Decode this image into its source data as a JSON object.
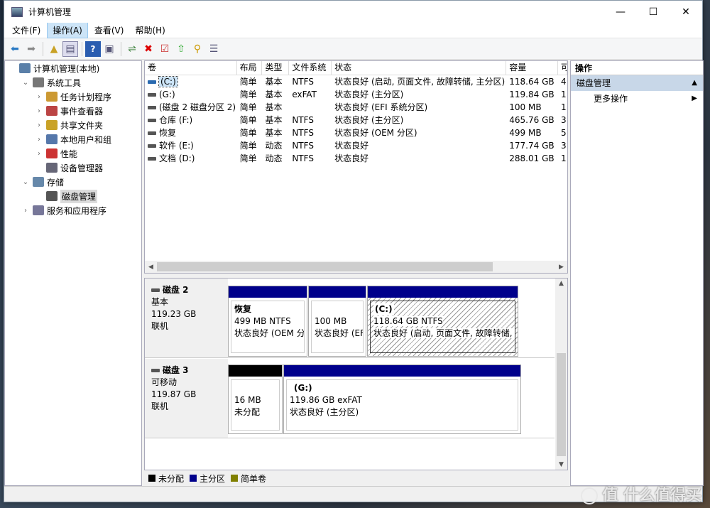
{
  "window": {
    "title": "计算机管理"
  },
  "controls": {
    "minimize": "—",
    "maximize": "☐",
    "close": "✕"
  },
  "menus": [
    "文件(F)",
    "操作(A)",
    "查看(V)",
    "帮助(H)"
  ],
  "toolbar_icons": [
    "back-icon",
    "forward-icon",
    "up-folder-icon",
    "show-tree-icon",
    "help-icon",
    "properties-icon",
    "connect-icon",
    "delete-icon",
    "checklist-icon",
    "import-icon",
    "search-icon",
    "export-icon"
  ],
  "tree": [
    {
      "label": "计算机管理(本地)",
      "level": 0,
      "arrow": "",
      "icon": "computer-icon"
    },
    {
      "label": "系统工具",
      "level": 1,
      "arrow": "v",
      "icon": "tools-icon"
    },
    {
      "label": "任务计划程序",
      "level": 2,
      "arrow": ">",
      "icon": "clock-icon"
    },
    {
      "label": "事件查看器",
      "level": 2,
      "arrow": ">",
      "icon": "event-icon"
    },
    {
      "label": "共享文件夹",
      "level": 2,
      "arrow": ">",
      "icon": "share-icon"
    },
    {
      "label": "本地用户和组",
      "level": 2,
      "arrow": ">",
      "icon": "users-icon"
    },
    {
      "label": "性能",
      "level": 2,
      "arrow": ">",
      "icon": "performance-icon"
    },
    {
      "label": "设备管理器",
      "level": 2,
      "arrow": "",
      "icon": "device-icon"
    },
    {
      "label": "存储",
      "level": 1,
      "arrow": "v",
      "icon": "storage-icon"
    },
    {
      "label": "磁盘管理",
      "level": 2,
      "arrow": "",
      "icon": "disk-icon",
      "selected": true
    },
    {
      "label": "服务和应用程序",
      "level": 1,
      "arrow": ">",
      "icon": "services-icon"
    }
  ],
  "volume_headers": [
    "卷",
    "布局",
    "类型",
    "文件系统",
    "状态",
    "容量",
    "可"
  ],
  "volumes": [
    [
      "(C:)",
      "简单",
      "基本",
      "NTFS",
      "状态良好 (启动, 页面文件, 故障转储, 主分区)",
      "118.64 GB",
      "4"
    ],
    [
      "(G:)",
      "简单",
      "基本",
      "exFAT",
      "状态良好 (主分区)",
      "119.84 GB",
      "1"
    ],
    [
      "(磁盘 2 磁盘分区 2)",
      "简单",
      "基本",
      "",
      "状态良好 (EFI 系统分区)",
      "100 MB",
      "1"
    ],
    [
      "仓库 (F:)",
      "简单",
      "基本",
      "NTFS",
      "状态良好 (主分区)",
      "465.76 GB",
      "3"
    ],
    [
      "恢复",
      "简单",
      "基本",
      "NTFS",
      "状态良好 (OEM 分区)",
      "499 MB",
      "5"
    ],
    [
      "软件 (E:)",
      "简单",
      "动态",
      "NTFS",
      "状态良好",
      "177.74 GB",
      "3"
    ],
    [
      "文档 (D:)",
      "简单",
      "动态",
      "NTFS",
      "状态良好",
      "288.01 GB",
      "1"
    ]
  ],
  "disk2": {
    "name": "磁盘 2",
    "type": "基本",
    "size": "119.23 GB",
    "status": "联机",
    "p1": {
      "name": "恢复",
      "size": "499 MB NTFS",
      "status": "状态良好 (OEM 分"
    },
    "p2": {
      "size": "100 MB",
      "status": "状态良好 (EF"
    },
    "p3": {
      "name": "(C:)",
      "size": "118.64 GB NTFS",
      "status": "状态良好 (启动, 页面文件, 故障转储, 主"
    }
  },
  "disk3": {
    "name": "磁盘 3",
    "type": "可移动",
    "size": "119.87 GB",
    "status": "联机",
    "p1": {
      "size": "16 MB",
      "status": "未分配"
    },
    "p2": {
      "name": "(G:)",
      "size": "119.86 GB exFAT",
      "status": "状态良好 (主分区)"
    }
  },
  "legend": [
    {
      "label": "未分配",
      "color": "#000000"
    },
    {
      "label": "主分区",
      "color": "#00008b"
    },
    {
      "label": "简单卷",
      "color": "#808000"
    }
  ],
  "actions": {
    "header": "操作",
    "section": "磁盘管理",
    "more": "更多操作"
  },
  "watermark": "值 什么值得买"
}
